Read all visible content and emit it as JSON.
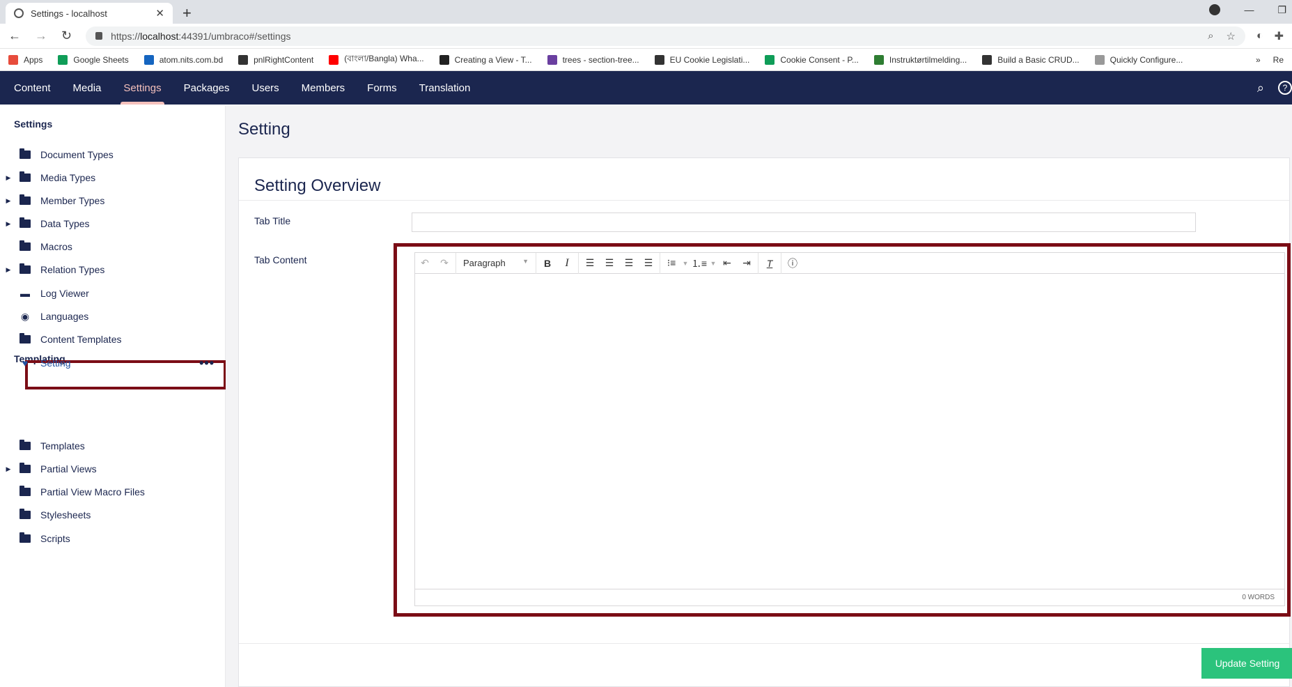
{
  "browser": {
    "tab_title": "Settings - localhost",
    "url_prefix": "https://",
    "url_host": "localhost",
    "url_rest": ":44391/umbraco#/settings",
    "bookmarks": [
      {
        "label": "Apps",
        "color": "#e74c3c"
      },
      {
        "label": "Google Sheets",
        "color": "#0f9d58"
      },
      {
        "label": "atom.nits.com.bd",
        "color": "#1565c0"
      },
      {
        "label": "pnlRightContent",
        "color": "#333333"
      },
      {
        "label": "(বাংলা/Bangla) Wha...",
        "color": "#ff0000"
      },
      {
        "label": "Creating a View - T...",
        "color": "#222222"
      },
      {
        "label": "trees - section-tree...",
        "color": "#6a3fa0"
      },
      {
        "label": "EU Cookie Legislati...",
        "color": "#333333"
      },
      {
        "label": "Cookie Consent - P...",
        "color": "#0f9d58"
      },
      {
        "label": "Instruktørtilmelding...",
        "color": "#2e7d32"
      },
      {
        "label": "Build a Basic CRUD...",
        "color": "#333333"
      },
      {
        "label": "Quickly Configure...",
        "color": "#999999"
      }
    ],
    "bookmarks_more": "»",
    "reading_list": "Re"
  },
  "nav": {
    "items": [
      "Content",
      "Media",
      "Settings",
      "Packages",
      "Users",
      "Members",
      "Forms",
      "Translation"
    ],
    "active_index": 2
  },
  "sidebar": {
    "settings_heading": "Settings",
    "settings_items": [
      {
        "label": "Document Types",
        "icon": "folder-icon",
        "expandable": false
      },
      {
        "label": "Media Types",
        "icon": "folder-icon",
        "expandable": true
      },
      {
        "label": "Member Types",
        "icon": "folder-icon",
        "expandable": true
      },
      {
        "label": "Data Types",
        "icon": "folder-icon",
        "expandable": true
      },
      {
        "label": "Macros",
        "icon": "folder-icon",
        "expandable": false
      },
      {
        "label": "Relation Types",
        "icon": "folder-icon",
        "expandable": true
      },
      {
        "label": "Log Viewer",
        "icon": "archive-icon",
        "expandable": false
      },
      {
        "label": "Languages",
        "icon": "globe-icon",
        "expandable": false
      },
      {
        "label": "Content Templates",
        "icon": "folder-icon",
        "expandable": false
      },
      {
        "label": "Setting",
        "icon": "heart-icon",
        "expandable": false,
        "selected": true
      }
    ],
    "more_actions": "•••",
    "templating_heading": "Templating",
    "templating_items": [
      {
        "label": "Templates",
        "expandable": false
      },
      {
        "label": "Partial Views",
        "expandable": true
      },
      {
        "label": "Partial View Macro Files",
        "expandable": false
      },
      {
        "label": "Stylesheets",
        "expandable": false
      },
      {
        "label": "Scripts",
        "expandable": false
      }
    ]
  },
  "page": {
    "title": "Setting",
    "panel_title": "Setting Overview",
    "tab_title_label": "Tab Title",
    "tab_title_value": "",
    "tab_content_label": "Tab Content",
    "editor": {
      "format_select": "Paragraph",
      "word_count": "0 WORDS"
    },
    "update_button": "Update Setting"
  },
  "colors": {
    "header_bg": "#1b264f",
    "active_nav": "#f5c1bc",
    "highlight_border": "#7b0d16",
    "update_button": "#2bc37c"
  }
}
